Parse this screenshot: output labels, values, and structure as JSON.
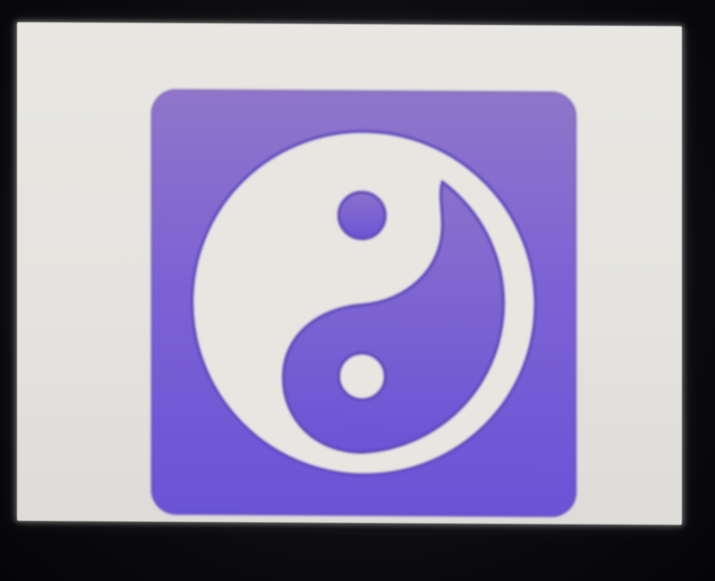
{
  "display": {
    "background_color": "#e6e5e1",
    "bezel_color": "#0c0b0f"
  },
  "icon": {
    "name": "yin-yang-icon",
    "tile_color_top": "#8f76c9",
    "tile_color_bottom": "#6a53d6",
    "symbol_color": "#e8e6e1",
    "symbol_outline_color": "#5a44b8"
  }
}
